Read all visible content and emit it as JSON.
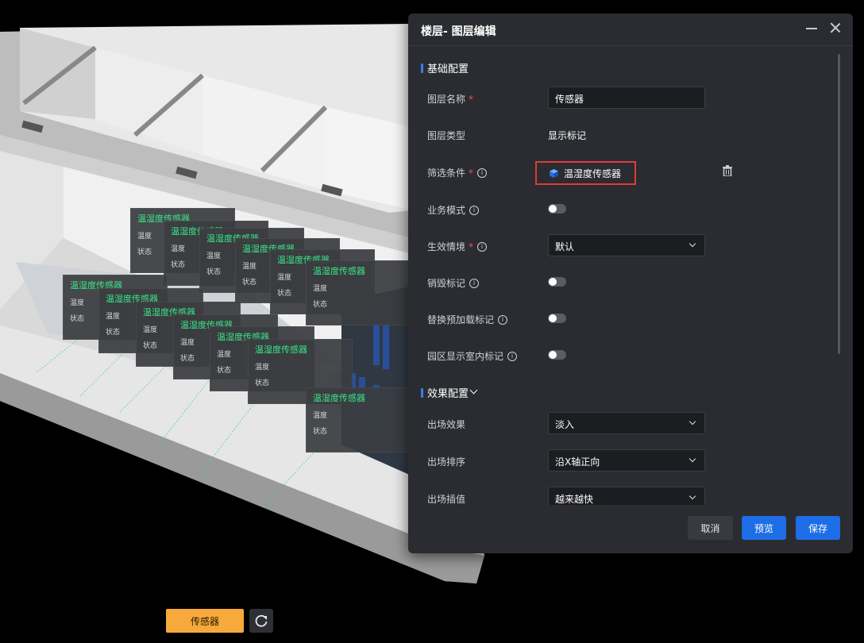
{
  "scene": {
    "tags": [
      {
        "title": "温湿度传感器",
        "row1": "温度",
        "row2": "状态"
      },
      {
        "title": "温湿度传感器",
        "row1": "温度",
        "row2": "状态"
      },
      {
        "title": "温湿度传感器",
        "row1": "温度",
        "row2": "状态"
      },
      {
        "title": "温湿度传感器",
        "row1": "温度",
        "row2": "状态"
      },
      {
        "title": "温湿度传感器",
        "row1": "温度",
        "row2": "状态"
      },
      {
        "title": "温湿度传感器",
        "row1": "温度",
        "row2": "状态"
      },
      {
        "title": "温湿度传感器",
        "row1": "温度",
        "row2": "状态"
      },
      {
        "title": "温湿度传感器",
        "row1": "温度",
        "row2": "状态"
      },
      {
        "title": "温湿度传感器",
        "row1": "温度",
        "row2": "状态"
      },
      {
        "title": "温湿度传感器",
        "row1": "温度",
        "row2": "状态"
      },
      {
        "title": "温湿度传感器",
        "row1": "温度",
        "row2": "状态"
      },
      {
        "title": "温湿度传感器",
        "row1": "温度",
        "row2": "状态"
      },
      {
        "title": "温湿度传感器",
        "row1": "温度",
        "row2": "状态"
      }
    ]
  },
  "dialog": {
    "title": "楼层- 图层编辑",
    "basic": {
      "heading": "基础配置",
      "layer_name_label": "图层名称",
      "layer_name_value": "传感器",
      "layer_type_label": "图层类型",
      "layer_type_value": "显示标记",
      "filter_label": "筛选条件",
      "filter_chip": "温湿度传感器",
      "business_mode_label": "业务模式",
      "context_label": "生效情境",
      "context_value": "默认",
      "destroy_label": "销毁标记",
      "preload_label": "替换预加载标记",
      "indoor_label": "园区显示室内标记"
    },
    "effect": {
      "heading": "效果配置",
      "enter_effect_label": "出场效果",
      "enter_effect_value": "淡入",
      "enter_order_label": "出场排序",
      "enter_order_value": "沿X轴正向",
      "enter_interp_label": "出场插值",
      "enter_interp_value": "越来越快"
    },
    "buttons": {
      "cancel": "取消",
      "preview": "预览",
      "save": "保存"
    }
  },
  "bottom": {
    "sensor_button": "传感器"
  },
  "colors": {
    "accent": "#1d6ee6",
    "sensor_button": "#f7a93b",
    "tag_title": "#38e68a",
    "highlight": "#e13a3a"
  }
}
